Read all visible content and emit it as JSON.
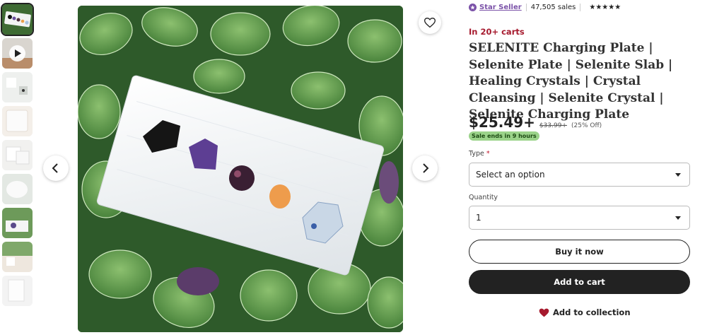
{
  "seller": {
    "badge_label": "Star Seller",
    "sales": "47,505 sales",
    "rating_stars": "★★★★★",
    "accent_color": "#7b52a8"
  },
  "carts_text": "In 20+ carts",
  "product": {
    "title": "SELENITE Charging Plate | Selenite Plate | Selenite Slab | Healing Crystals | Crystal Cleansing | Selenite Crystal | Selenite Charging Plate",
    "price": "$25.49+",
    "original_price": "$33.99+",
    "discount": "(25% Off)",
    "sale_badge": "Sale ends in 9 hours"
  },
  "options": {
    "type_label": "Type",
    "type_required_mark": "*",
    "type_value": "Select an option",
    "quantity_label": "Quantity",
    "quantity_value": "1"
  },
  "actions": {
    "buy_now": "Buy it now",
    "add_to_cart": "Add to cart",
    "add_to_collection": "Add to collection"
  },
  "icons": {
    "favorite": "heart-outline-icon",
    "prev": "chevron-left-icon",
    "next": "chevron-right-icon",
    "collection": "heart-filled-icon",
    "video": "play-icon"
  }
}
